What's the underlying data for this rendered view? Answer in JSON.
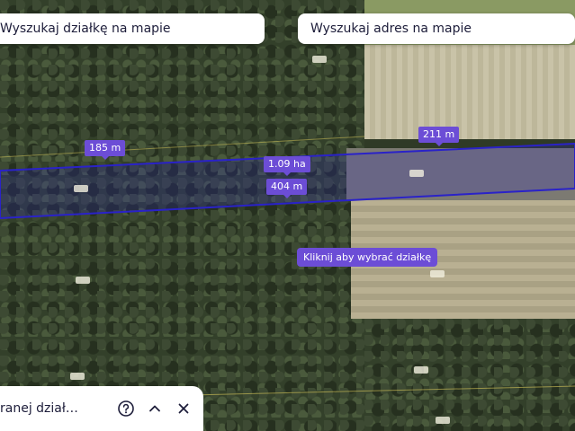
{
  "search": {
    "parcel_placeholder": "Wyszukaj działkę na mapie",
    "address_placeholder": "Wyszukaj adres na mapie"
  },
  "measurements": {
    "left_segment": "185 m",
    "right_segment": "211 m",
    "area": "1.09 ha",
    "bottom_segment": "404 m"
  },
  "hint": "Kliknij aby wybrać działkę",
  "bottom_panel": {
    "text": "ranej dział…",
    "help_icon": "help-circle-icon",
    "collapse_icon": "chevron-up-icon",
    "close_icon": "close-icon"
  },
  "colors": {
    "accent": "#6c4dd6",
    "parcel_outline": "#2a22c8"
  }
}
